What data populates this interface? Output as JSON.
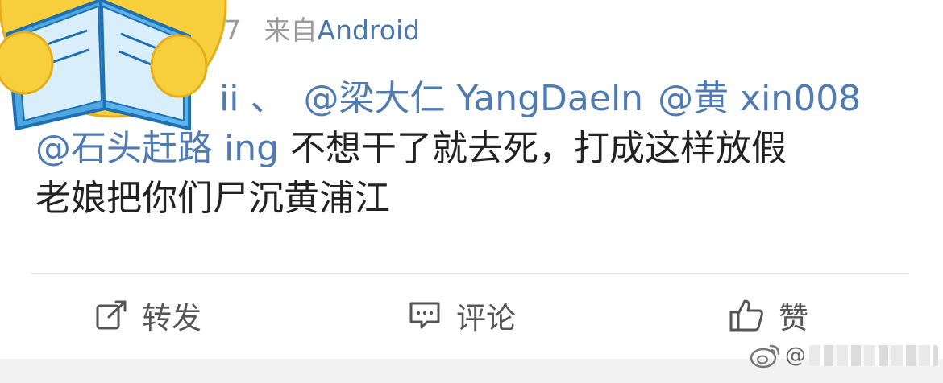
{
  "post": {
    "meta_partial": "7",
    "meta_from": "来自",
    "meta_source": "Android",
    "content": {
      "line1_mention_a": "ii",
      "line1_sep": "、",
      "line1_mention_b": "@梁大仁 YangDaeln",
      "line1_mention_c": "@黄 xin008",
      "line2_mention": "@石头赶路 ing",
      "line2_text": "不想干了就去死，打成这样放假",
      "line3_text": "老娘把你们尸沉黄浦江"
    }
  },
  "actions": {
    "repost": {
      "label": "转发",
      "icon": "share-edit-icon"
    },
    "comment": {
      "label": "评论",
      "icon": "comment-bubble-icon"
    },
    "like": {
      "label": "赞",
      "icon": "thumbs-up-icon"
    }
  },
  "watermark": {
    "at": "@",
    "icon": "weibo-logo-icon"
  },
  "avatar": {
    "icon": "emoji-reading-book-icon"
  },
  "colors": {
    "mention": "#4f7bb3",
    "source": "#4a77b0",
    "text": "#222222",
    "meta": "#9a9a9a",
    "action": "#555555"
  }
}
